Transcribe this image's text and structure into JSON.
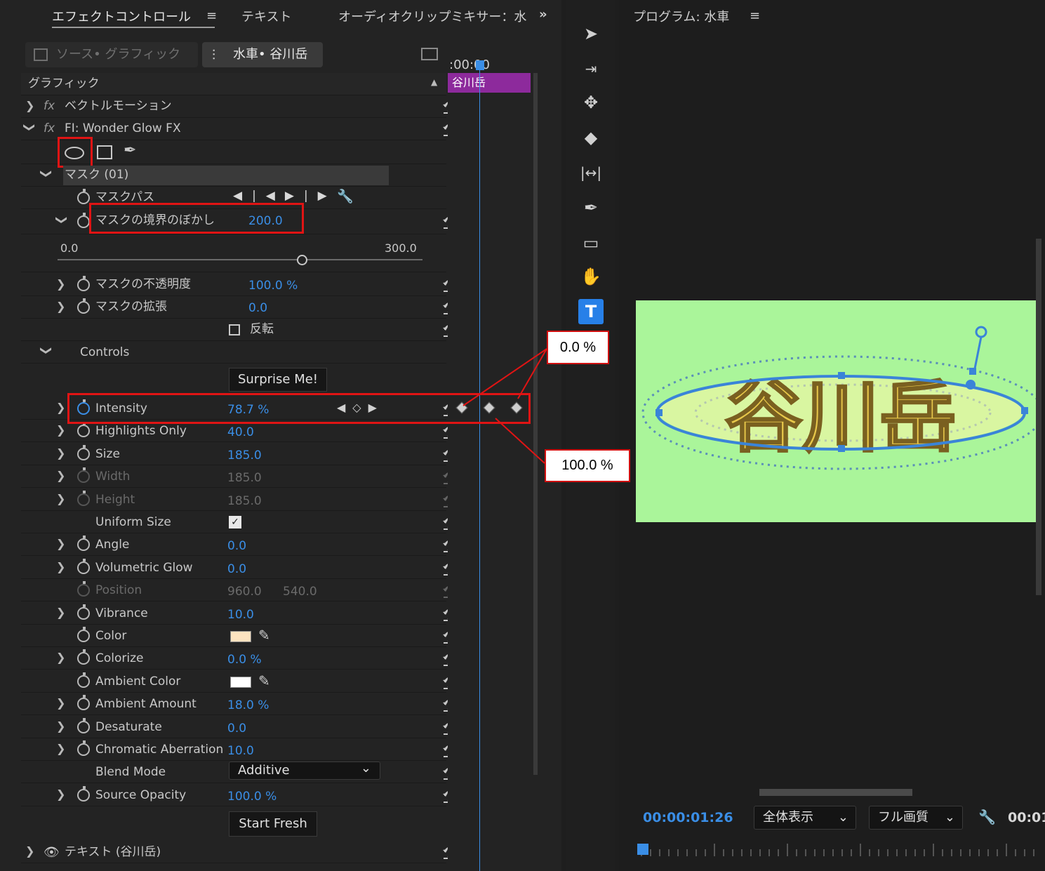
{
  "tabs": {
    "effect_controls": "エフェクトコントロール",
    "text": "テキスト",
    "audio_mixer": "オーディオクリップミキサー：水"
  },
  "clip_selector": {
    "source": "ソース• グラフィック",
    "clip": "水車• 谷川岳"
  },
  "timeline": {
    "timecode_head": ":00:00",
    "clip_label": "谷川岳"
  },
  "section": {
    "graphic": "グラフィック"
  },
  "effects": {
    "vector_motion": "ベクトルモーション",
    "wonder_glow": "FI: Wonder Glow FX",
    "mask": "マスク (01)",
    "mask_path": "マスクパス",
    "mask_feather": {
      "label": "マスクの境界のぼかし",
      "value": "200.0",
      "min": "0.0",
      "max": "300.0"
    },
    "mask_opacity": {
      "label": "マスクの不透明度",
      "value": "100.0 %"
    },
    "mask_expansion": {
      "label": "マスクの拡張",
      "value": "0.0"
    },
    "invert": "反転",
    "controls": "Controls",
    "surprise": "Surprise Me!",
    "start_fresh": "Start Fresh",
    "text_layer": "テキスト (谷川岳)"
  },
  "params": [
    {
      "label": "Intensity",
      "value": "78.7 %"
    },
    {
      "label": "Highlights Only",
      "value": "40.0"
    },
    {
      "label": "Size",
      "value": "185.0"
    },
    {
      "label": "Width",
      "value": "185.0"
    },
    {
      "label": "Height",
      "value": "185.0"
    },
    {
      "label": "Uniform Size",
      "value": ""
    },
    {
      "label": "Angle",
      "value": "0.0"
    },
    {
      "label": "Volumetric Glow",
      "value": "0.0"
    },
    {
      "label": "Position",
      "value": "960.0",
      "value2": "540.0"
    },
    {
      "label": "Vibrance",
      "value": "10.0"
    },
    {
      "label": "Color",
      "value": ""
    },
    {
      "label": "Colorize",
      "value": "0.0 %"
    },
    {
      "label": "Ambient Color",
      "value": ""
    },
    {
      "label": "Ambient Amount",
      "value": "18.0 %"
    },
    {
      "label": "Desaturate",
      "value": "0.0"
    },
    {
      "label": "Chromatic Aberration",
      "value": "10.0"
    },
    {
      "label": "Blend Mode",
      "value": "Additive"
    },
    {
      "label": "Source Opacity",
      "value": "100.0 %"
    }
  ],
  "colors": {
    "color_swatch": "#fde3c0",
    "ambient_swatch": "#ffffff",
    "accent": "#3a8ee6",
    "preview_bg": "#aaf59a",
    "highlight_box": "#e01414"
  },
  "callouts": {
    "top": "0.0 %",
    "bottom": "100.0 %"
  },
  "program": {
    "title": "プログラム: 水車",
    "preview_text": "谷川岳",
    "timecode": "00:00:01:26",
    "fit": "全体表示",
    "quality": "フル画質",
    "timecode_right": "00:01"
  },
  "icons": [
    "menu-icon",
    "overflow-chevrons-icon",
    "selection-arrow-icon",
    "track-select-icon",
    "ripple-edit-icon",
    "razor-icon",
    "slip-icon",
    "pen-icon",
    "rectangle-icon",
    "hand-icon",
    "type-tool-icon",
    "ellipse-mask-icon",
    "rect-mask-icon",
    "pen-mask-icon",
    "wrench-icon",
    "eyedropper-icon",
    "stopwatch-icon",
    "reset-icon",
    "keyframe-icon"
  ]
}
